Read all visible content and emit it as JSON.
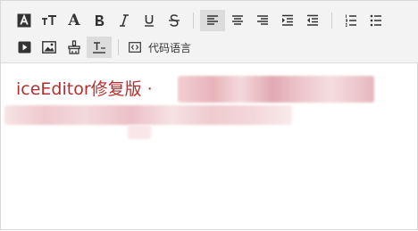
{
  "toolbar": {
    "row1": [
      {
        "name": "heading-icon",
        "kind": "icon"
      },
      {
        "name": "font-size-icon",
        "kind": "icon"
      },
      {
        "name": "font-color-icon",
        "kind": "icon"
      },
      {
        "name": "bold-icon",
        "kind": "icon"
      },
      {
        "name": "italic-icon",
        "kind": "icon"
      },
      {
        "name": "underline-icon",
        "kind": "icon"
      },
      {
        "name": "strikethrough-icon",
        "kind": "icon"
      },
      {
        "name": "align-left-icon",
        "kind": "icon",
        "active": true
      },
      {
        "name": "align-center-icon",
        "kind": "icon"
      },
      {
        "name": "align-right-icon",
        "kind": "icon"
      },
      {
        "name": "indent-icon",
        "kind": "icon"
      },
      {
        "name": "outdent-icon",
        "kind": "icon"
      },
      {
        "name": "ordered-list-icon",
        "kind": "icon"
      },
      {
        "name": "unordered-list-icon",
        "kind": "icon"
      }
    ],
    "row2": [
      {
        "name": "video-icon",
        "kind": "icon"
      },
      {
        "name": "image-icon",
        "kind": "icon"
      },
      {
        "name": "format-painter-icon",
        "kind": "icon"
      },
      {
        "name": "clear-format-icon",
        "kind": "icon",
        "active": true
      }
    ],
    "code_language_label": "代码语言"
  },
  "content": {
    "line1_text": "iceEditor修复版 ·"
  }
}
